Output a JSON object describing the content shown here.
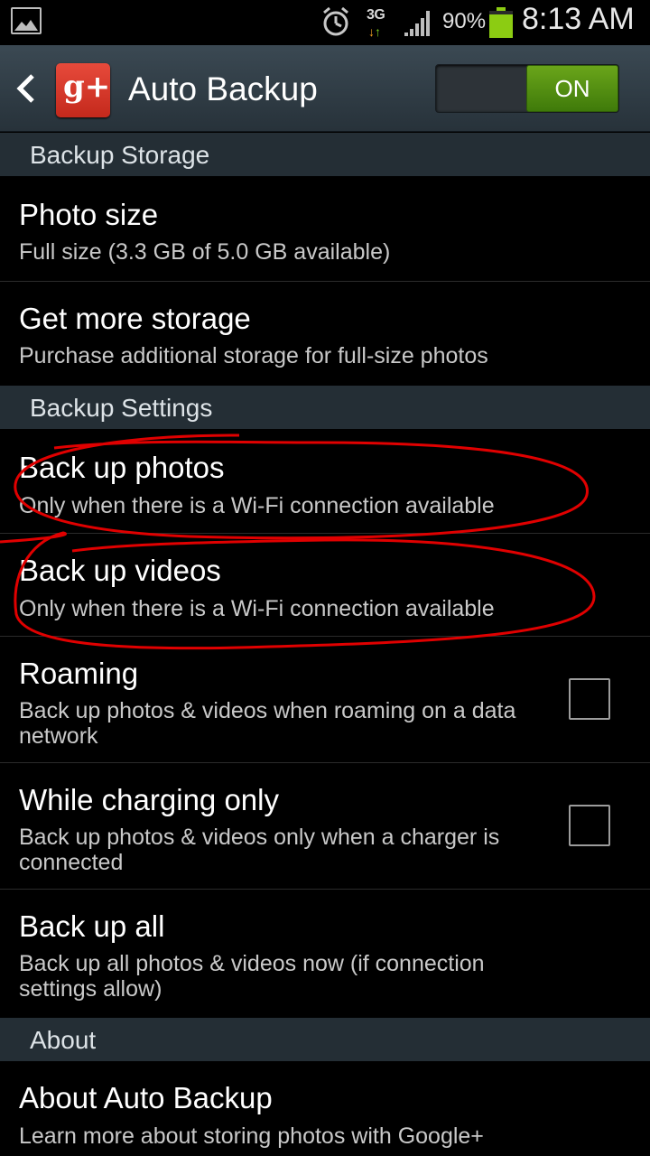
{
  "status_bar": {
    "network": "3G",
    "battery_percent": "90%",
    "time": "8:13 AM",
    "battery_level": 0.9,
    "battery_color": "#8ccc12"
  },
  "action_bar": {
    "title": "Auto Backup",
    "app_icon_text": "g+",
    "toggle_label": "ON",
    "toggle_state": true
  },
  "sections": {
    "storage": "Backup Storage",
    "settings": "Backup Settings",
    "about": "About"
  },
  "items": {
    "photo_size": {
      "title": "Photo size",
      "subtitle": "Full size (3.3 GB of 5.0 GB available)"
    },
    "more_storage": {
      "title": "Get more storage",
      "subtitle": "Purchase additional storage for full-size photos"
    },
    "backup_photos": {
      "title": "Back up photos",
      "subtitle": "Only when there is a Wi-Fi connection available"
    },
    "backup_videos": {
      "title": "Back up videos",
      "subtitle": "Only when there is a Wi-Fi connection available"
    },
    "roaming": {
      "title": "Roaming",
      "subtitle": "Back up photos & videos when roaming on a data network",
      "checked": false
    },
    "charging": {
      "title": "While charging only",
      "subtitle": "Back up photos & videos only when a charger is connected",
      "checked": false
    },
    "backup_all": {
      "title": "Back up all",
      "subtitle": "Back up all photos & videos now (if connection settings allow)"
    },
    "about_auto": {
      "title": "About Auto Backup",
      "subtitle": "Learn more about storing photos with Google+"
    }
  },
  "colors": {
    "accent_green": "#5a9a14",
    "gplus_red": "#d93a2b",
    "annotation_red": "#e00000"
  }
}
